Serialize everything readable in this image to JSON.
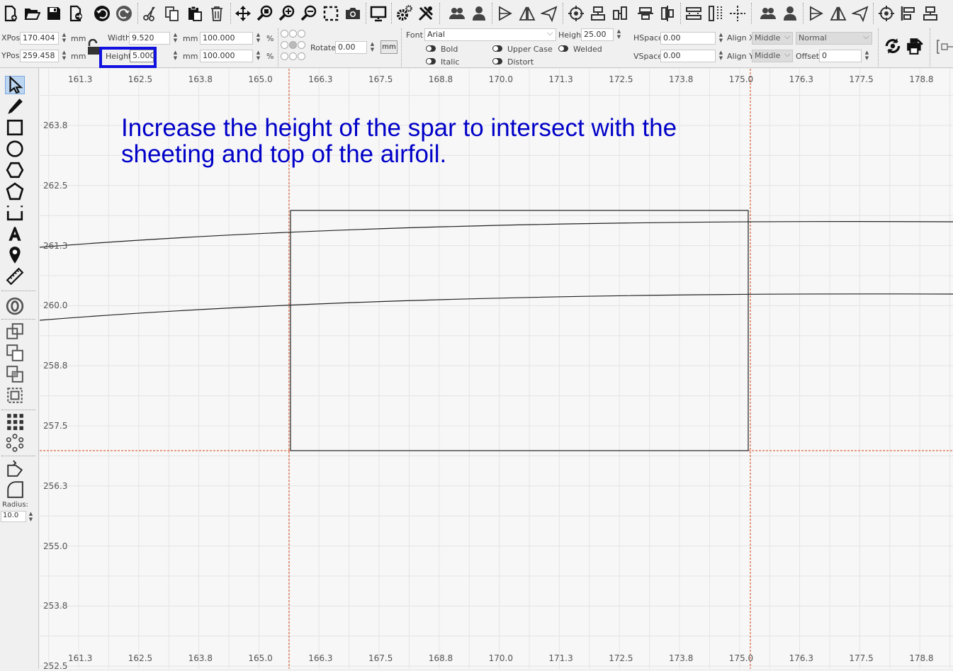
{
  "toolbar": {
    "icons": [
      "new-file-icon",
      "open-icon",
      "save-icon",
      "export-icon",
      "undo-icon",
      "redo-icon",
      "cut-icon",
      "copy-icon",
      "paste-icon",
      "delete-icon",
      "move-icon",
      "zoom-icon",
      "zoom-in-icon",
      "zoom-out-icon",
      "select-frame-icon",
      "camera-icon",
      "monitor-icon",
      "settings-icon",
      "tools-icon",
      "group-icon",
      "user-icon",
      "flip-h-icon",
      "mirror-icon",
      "arrow-icon",
      "target-icon",
      "align-center-icon",
      "distribute-icon",
      "align-middle-icon",
      "align-bottom-icon",
      "space-h-icon",
      "space-v-icon",
      "crosshair-icon",
      "group2-icon",
      "user2-icon",
      "flip2-icon",
      "mirror2-icon",
      "arrow2-icon",
      "target2-icon",
      "align-left-icon",
      "align-center2-icon"
    ]
  },
  "props": {
    "xpos_label": "XPos",
    "xpos_value": "170.404",
    "xpos_unit": "mm",
    "ypos_label": "YPos",
    "ypos_value": "259.458",
    "ypos_unit": "mm",
    "width_label": "Width",
    "width_value": "9.520",
    "width_unit": "mm",
    "height_label": "Height",
    "height_value": "5.000",
    "height_unit": "mm",
    "scale_w": "100.000",
    "scale_h": "100.000",
    "pct": "%",
    "rotate_label": "Rotate",
    "rotate_value": "0.00",
    "mm_button": "mm",
    "font_label": "Font",
    "font_value": "Arial",
    "font_height_label": "Height",
    "font_height_value": "25.00",
    "bold": "Bold",
    "italic": "Italic",
    "upper": "Upper Case",
    "distort": "Distort",
    "welded": "Welded",
    "hspace_label": "HSpace",
    "hspace_value": "0.00",
    "vspace_label": "VSpace",
    "vspace_value": "0.00",
    "alignx_label": "Align X",
    "alignx_value": "Middle",
    "aligny_label": "Align Y",
    "aligny_value": "Middle",
    "normal_value": "Normal",
    "offset_label": "Offset",
    "offset_value": "0"
  },
  "sidebar": {
    "radius_label": "Radius:",
    "radius_value": "10.0"
  },
  "ruler": {
    "x_labels": [
      "161.3",
      "162.5",
      "163.8",
      "165.0",
      "166.3",
      "167.5",
      "168.8",
      "170.0",
      "171.3",
      "172.5",
      "173.8",
      "175.0",
      "176.3",
      "177.5",
      "178.8"
    ],
    "y_labels": [
      "263.8",
      "262.5",
      "261.3",
      "260.0",
      "258.8",
      "257.5",
      "256.3",
      "255.0",
      "253.8",
      "252.5"
    ]
  },
  "annotation": {
    "text": "Increase the height of the spar to intersect with the sheeting and top of the airfoil.",
    "color": "#0000c8"
  }
}
